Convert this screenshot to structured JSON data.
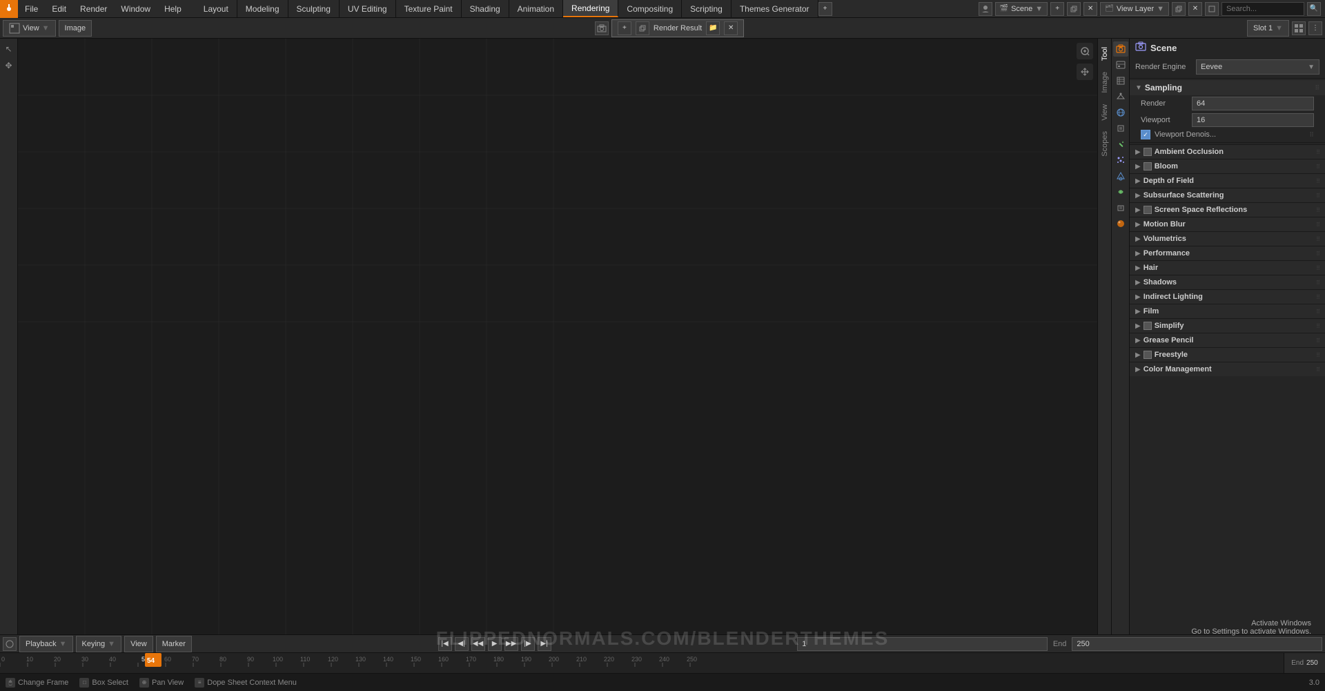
{
  "app": {
    "title": "Blender"
  },
  "topMenu": {
    "items": [
      {
        "id": "file",
        "label": "File"
      },
      {
        "id": "edit",
        "label": "Edit"
      },
      {
        "id": "render",
        "label": "Render"
      },
      {
        "id": "window",
        "label": "Window"
      },
      {
        "id": "help",
        "label": "Help"
      }
    ]
  },
  "workspaceTabs": [
    {
      "id": "layout",
      "label": "Layout",
      "active": false
    },
    {
      "id": "modeling",
      "label": "Modeling",
      "active": false
    },
    {
      "id": "sculpting",
      "label": "Sculpting",
      "active": false
    },
    {
      "id": "uv-editing",
      "label": "UV Editing",
      "active": false
    },
    {
      "id": "texture-paint",
      "label": "Texture Paint",
      "active": false
    },
    {
      "id": "shading",
      "label": "Shading",
      "active": false
    },
    {
      "id": "animation",
      "label": "Animation",
      "active": false
    },
    {
      "id": "rendering",
      "label": "Rendering",
      "active": true
    },
    {
      "id": "compositing",
      "label": "Compositing",
      "active": false
    },
    {
      "id": "scripting",
      "label": "Scripting",
      "active": false
    },
    {
      "id": "themes-generator",
      "label": "Themes Generator",
      "active": false
    }
  ],
  "sceneSelector": {
    "label": "Scene",
    "value": "Scene"
  },
  "viewLayerSelector": {
    "label": "View Layer",
    "value": "View Layer"
  },
  "secondToolbar": {
    "viewBtn": "View",
    "imageBtn": "Image",
    "slotLabel": "Slot 1",
    "renderResultLabel": "Render Result"
  },
  "verticalTabs": [
    {
      "id": "tool",
      "label": "Tool",
      "active": false
    },
    {
      "id": "image",
      "label": "Image",
      "active": false
    },
    {
      "id": "view",
      "label": "View",
      "active": false
    },
    {
      "id": "scopes",
      "label": "Scopes",
      "active": false
    }
  ],
  "propertiesPanel": {
    "title": "Scene",
    "renderEngine": {
      "label": "Render Engine",
      "value": "Eevee"
    },
    "samplingSection": {
      "title": "Sampling",
      "renderLabel": "Render",
      "renderValue": "64",
      "viewportLabel": "Viewport",
      "viewportValue": "16",
      "viewportDenoiseLabel": "Viewport Denois...",
      "viewportDenoiseChecked": true
    },
    "sections": [
      {
        "id": "ambient-occlusion",
        "label": "Ambient Occlusion",
        "hasCheckbox": true,
        "checked": false
      },
      {
        "id": "bloom",
        "label": "Bloom",
        "hasCheckbox": true,
        "checked": false
      },
      {
        "id": "depth-of-field",
        "label": "Depth of Field",
        "hasCheckbox": false
      },
      {
        "id": "subsurface-scattering",
        "label": "Subsurface Scattering",
        "hasCheckbox": false
      },
      {
        "id": "screen-space-reflections",
        "label": "Screen Space Reflections",
        "hasCheckbox": true,
        "checked": false
      },
      {
        "id": "motion-blur",
        "label": "Motion Blur",
        "hasCheckbox": false
      },
      {
        "id": "volumetrics",
        "label": "Volumetrics",
        "hasCheckbox": false
      },
      {
        "id": "performance",
        "label": "Performance",
        "hasCheckbox": false
      },
      {
        "id": "hair",
        "label": "Hair",
        "hasCheckbox": false
      },
      {
        "id": "shadows",
        "label": "Shadows",
        "hasCheckbox": false
      },
      {
        "id": "indirect-lighting",
        "label": "Indirect Lighting",
        "hasCheckbox": false
      },
      {
        "id": "film",
        "label": "Film",
        "hasCheckbox": false
      },
      {
        "id": "simplify",
        "label": "Simplify",
        "hasCheckbox": true,
        "checked": false
      },
      {
        "id": "grease-pencil",
        "label": "Grease Pencil",
        "hasCheckbox": false
      },
      {
        "id": "freestyle",
        "label": "Freestyle",
        "hasCheckbox": true,
        "checked": false
      },
      {
        "id": "color-management",
        "label": "Color Management",
        "hasCheckbox": false
      }
    ]
  },
  "propertyIcons": [
    {
      "id": "render",
      "symbol": "📷",
      "active": true,
      "color": "#e8750a"
    },
    {
      "id": "output",
      "symbol": "🖨",
      "active": false
    },
    {
      "id": "view-layer",
      "symbol": "🗂",
      "active": false
    },
    {
      "id": "scene",
      "symbol": "🎬",
      "active": false
    },
    {
      "id": "world",
      "symbol": "🌍",
      "active": false
    },
    {
      "id": "object",
      "symbol": "▣",
      "active": false
    },
    {
      "id": "modifier",
      "symbol": "🔧",
      "active": false
    },
    {
      "id": "particles",
      "symbol": "✦",
      "active": false
    },
    {
      "id": "physics",
      "symbol": "⚡",
      "active": false
    },
    {
      "id": "constraints",
      "symbol": "🔗",
      "active": false
    },
    {
      "id": "data",
      "symbol": "◉",
      "active": false
    },
    {
      "id": "material",
      "symbol": "⬤",
      "active": false
    }
  ],
  "timeline": {
    "playbackLabel": "Playback",
    "keyingLabel": "Keying",
    "viewLabel": "View",
    "markerLabel": "Marker",
    "startFrame": "1",
    "endLabel": "End",
    "endValue": "250",
    "currentFrame": "54",
    "ticks": [
      0,
      10,
      20,
      30,
      40,
      50,
      60,
      70,
      80,
      90,
      100,
      110,
      120,
      130,
      140,
      150,
      160,
      170,
      180,
      190,
      200,
      210,
      220,
      230,
      240,
      250
    ]
  },
  "statusBar": {
    "changeFrame": "Change Frame",
    "boxSelect": "Box Select",
    "panView": "Pan View",
    "dopeSheetContext": "Dope Sheet Context Menu",
    "zoomValue": "3.0"
  },
  "watermark": "FLIPPEDNORMALS.COM/BLENDERTHEMES",
  "activateWindows": {
    "line1": "Activate Windows",
    "line2": "Go to Settings to activate Windows."
  }
}
